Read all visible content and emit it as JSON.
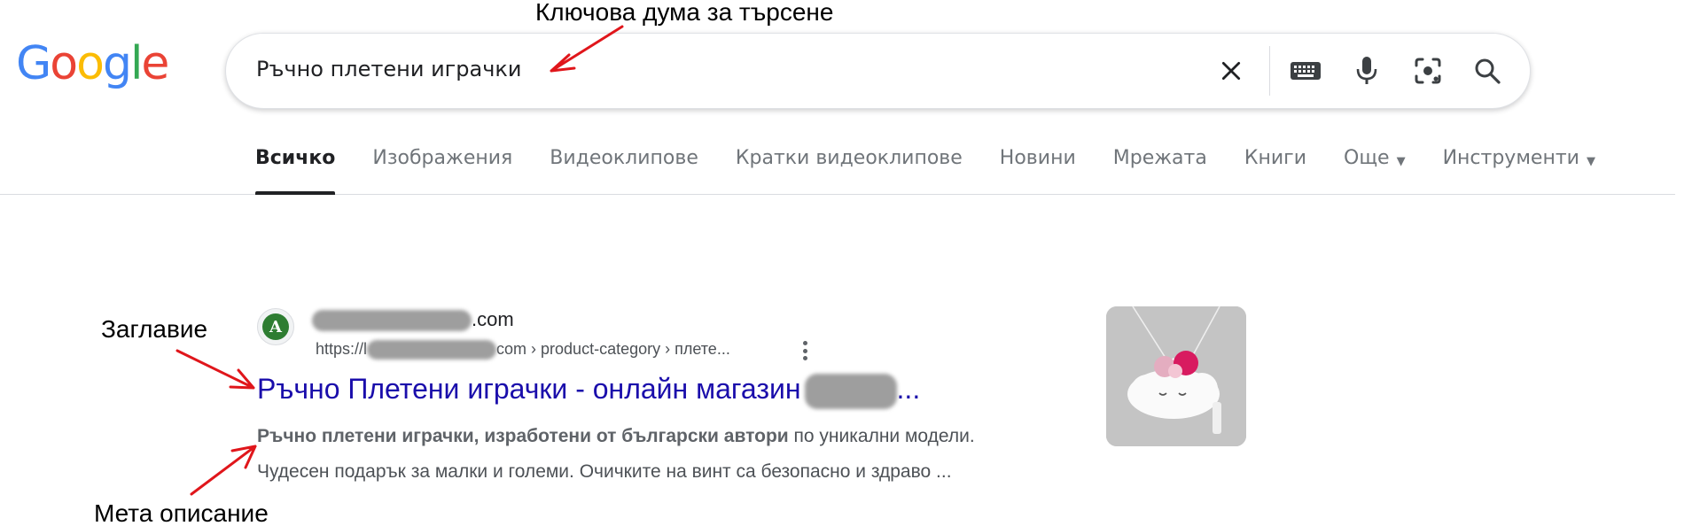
{
  "logo": {
    "text": "Google"
  },
  "search": {
    "query": "Ръчно плетени играчки",
    "icons": [
      "close-icon",
      "keyboard-icon",
      "microphone-icon",
      "lens-icon",
      "search-icon"
    ]
  },
  "tabs": [
    {
      "label": "Всичко",
      "active": true
    },
    {
      "label": "Изображения"
    },
    {
      "label": "Видеоклипове"
    },
    {
      "label": "Кратки видеоклипове"
    },
    {
      "label": "Новини"
    },
    {
      "label": "Мрежата"
    },
    {
      "label": "Книги"
    },
    {
      "label": "Още",
      "dropdown": true
    },
    {
      "label": "Инструменти",
      "dropdown": true
    }
  ],
  "result": {
    "site_name_suffix": ".com",
    "url_prefix": "https://l",
    "url_suffix": "com › product-category › плете...",
    "title": "Ръчно Плетени играчки - онлайн магазин",
    "title_tail": "...",
    "snippet_bold": "Ръчно плетени играчки, изработени от български автори",
    "snippet_rest": " по уникални модели.",
    "snippet_line2": "Чудесен подарък за малки и големи. Очичките на винт са безопасно и здраво ..."
  },
  "annotations": {
    "keyword": "Ключова дума за търсене",
    "title": "Заглавие",
    "meta": "Мета описание",
    "arrow_color": "#e0161b"
  },
  "colors": {
    "link": "#1a0dab",
    "logo_blue": "#4285f4",
    "logo_red": "#ea4335",
    "logo_yellow": "#fbbc05",
    "logo_green": "#34a853"
  }
}
